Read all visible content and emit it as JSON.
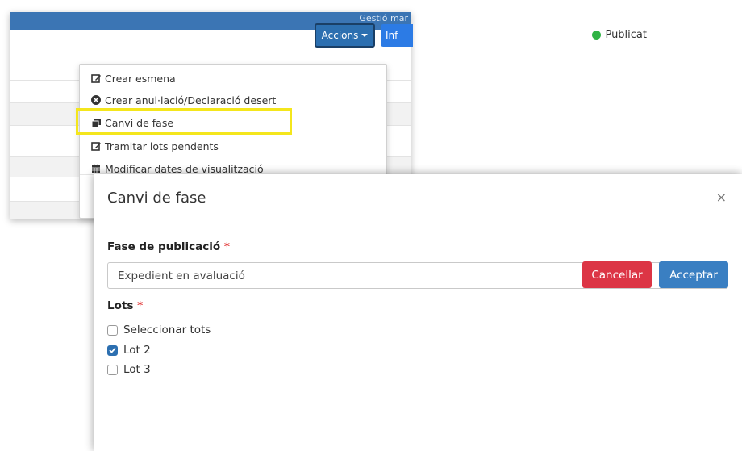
{
  "background": {
    "topbar_text": "Gestió mar",
    "status_label": "Publicat",
    "status_color": "#2fb344",
    "actions_button": "Accions",
    "info_button": "Inf"
  },
  "menu": {
    "items": [
      {
        "label": "Crear esmena",
        "icon": "edit-icon"
      },
      {
        "label": "Crear anul·lació/Declaració desert",
        "icon": "times-circle-icon"
      },
      {
        "label": "Canvi de fase",
        "icon": "clone-icon"
      },
      {
        "label": "Tramitar lots pendents",
        "icon": "edit-icon"
      },
      {
        "label": "Modificar dates de visualització",
        "icon": "calendar-icon"
      }
    ],
    "highlight_color": "#f4e61c"
  },
  "modal": {
    "title": "Canvi de fase",
    "close": "×",
    "phase_label": "Fase de publicació",
    "required_mark": "*",
    "phase_value": "Expedient en avaluació",
    "lots_label": "Lots",
    "checkboxes": [
      {
        "label": "Seleccionar tots",
        "checked": false
      },
      {
        "label": "Lot 2",
        "checked": true
      },
      {
        "label": "Lot 3",
        "checked": false
      }
    ],
    "cancel_button": "Cancellar",
    "accept_button": "Acceptar",
    "cancel_color": "#dc3545",
    "accept_color": "#3a7fc2"
  }
}
